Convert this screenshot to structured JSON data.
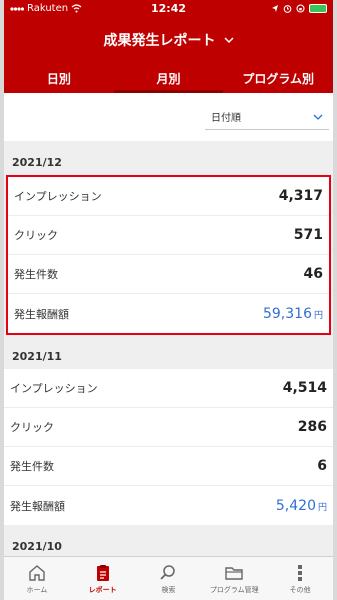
{
  "status": {
    "carrier": "Rakuten",
    "time": "12:42"
  },
  "header": {
    "title": "成果発生レポート"
  },
  "tabs": [
    {
      "label": "日別"
    },
    {
      "label": "月別"
    },
    {
      "label": "プログラム別"
    }
  ],
  "sort": {
    "selected": "日付順"
  },
  "months": [
    {
      "title": "2021/12",
      "rows": [
        {
          "label": "インプレッション",
          "value": "4,317"
        },
        {
          "label": "クリック",
          "value": "571"
        },
        {
          "label": "発生件数",
          "value": "46"
        },
        {
          "label": "発生報酬額",
          "value": "59,316",
          "unit": "円"
        }
      ]
    },
    {
      "title": "2021/11",
      "rows": [
        {
          "label": "インプレッション",
          "value": "4,514"
        },
        {
          "label": "クリック",
          "value": "286"
        },
        {
          "label": "発生件数",
          "value": "6"
        },
        {
          "label": "発生報酬額",
          "value": "5,420",
          "unit": "円"
        }
      ]
    },
    {
      "title": "2021/10"
    }
  ],
  "tabbar": [
    {
      "label": "ホーム",
      "icon": "home-icon"
    },
    {
      "label": "レポート",
      "icon": "report-icon"
    },
    {
      "label": "検索",
      "icon": "search-icon"
    },
    {
      "label": "プログラム管理",
      "icon": "folder-icon"
    },
    {
      "label": "その他",
      "icon": "more-icon"
    }
  ],
  "colors": {
    "brand": "#bf0000",
    "highlight": "#e60012",
    "reward": "#2f6fd6"
  }
}
